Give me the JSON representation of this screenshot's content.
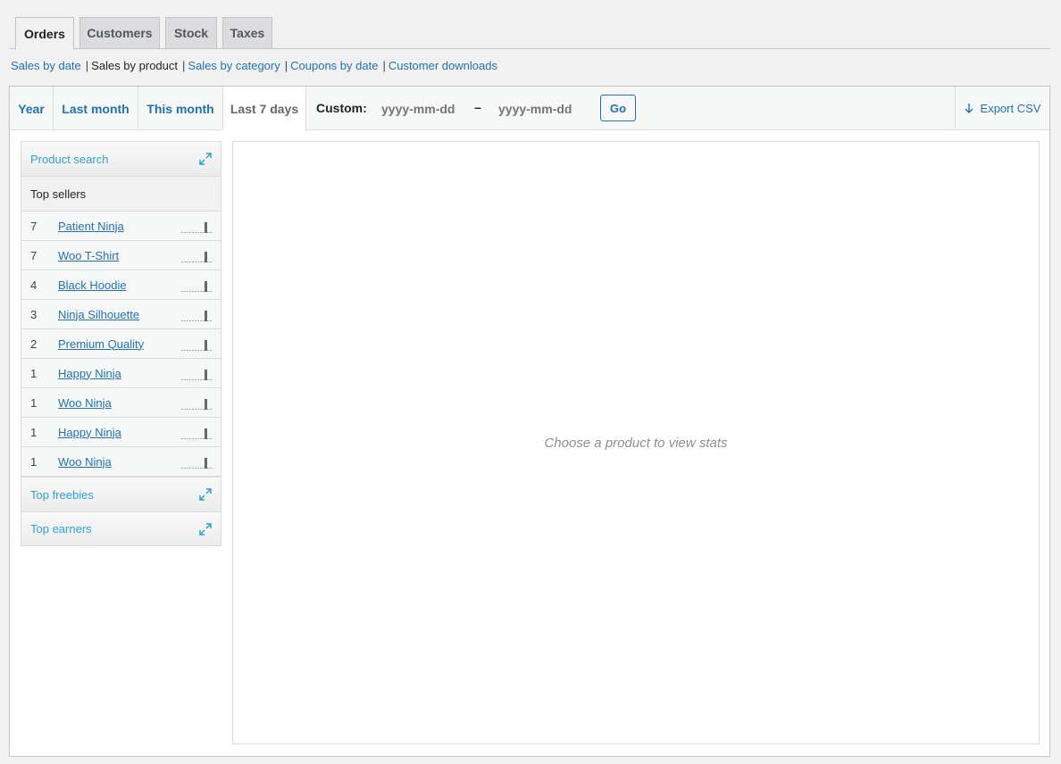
{
  "tabs": [
    "Orders",
    "Customers",
    "Stock",
    "Taxes"
  ],
  "subnav": {
    "sales_by_date": "Sales by date",
    "sales_by_product": "Sales by product",
    "sales_by_category": "Sales by category",
    "coupons_by_date": "Coupons by date",
    "customer_downloads": "Customer downloads",
    "separator": "|"
  },
  "range": {
    "year": "Year",
    "last_month": "Last month",
    "this_month": "This month",
    "last_7_days": "Last 7 days",
    "custom_label": "Custom:",
    "start_placeholder": "yyyy-mm-dd",
    "end_placeholder": "yyyy-mm-dd",
    "dash": "–",
    "go": "Go",
    "export": "Export CSV"
  },
  "sidebar": {
    "product_search": "Product search",
    "top_sellers": "Top sellers",
    "top_freebies": "Top freebies",
    "top_earners": "Top earners",
    "sellers": [
      {
        "count": "7",
        "name": "Patient Ninja"
      },
      {
        "count": "7",
        "name": "Woo T-Shirt"
      },
      {
        "count": "4",
        "name": "Black Hoodie"
      },
      {
        "count": "3",
        "name": "Ninja Silhouette"
      },
      {
        "count": "2",
        "name": "Premium Quality"
      },
      {
        "count": "1",
        "name": "Happy Ninja"
      },
      {
        "count": "1",
        "name": "Woo Ninja"
      },
      {
        "count": "1",
        "name": "Happy Ninja"
      },
      {
        "count": "1",
        "name": "Woo Ninja"
      }
    ]
  },
  "main": {
    "placeholder": "Choose a product to view stats"
  },
  "colors": {
    "link": "#2271b1",
    "widget_link": "#2ea2cc"
  }
}
